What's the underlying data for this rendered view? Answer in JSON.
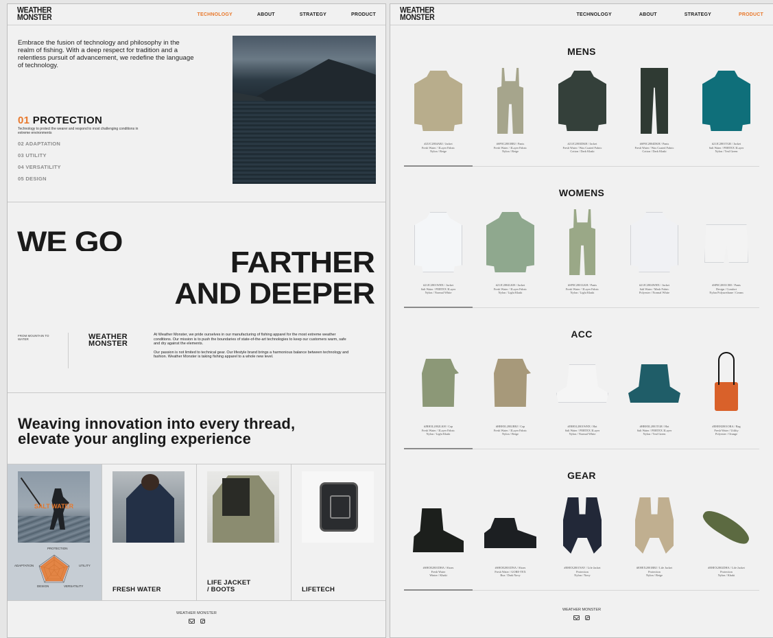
{
  "left": {
    "logo": [
      "WEATHER",
      "MONSTER"
    ],
    "nav": [
      {
        "label": "TECHNOLOGY",
        "active": true
      },
      {
        "label": "ABOUT",
        "active": false
      },
      {
        "label": "STRATEGY",
        "active": false
      },
      {
        "label": "PRODUCT",
        "active": false
      }
    ],
    "intro": "Embrace the fusion of technology and philosophy in the realm of fishing. With a deep respect for tradition and a relentless pursuit of advancement, we redefine the language of technology.",
    "tech": {
      "active_num": "01",
      "active_label": "PROTECTION",
      "active_desc": "Technology to protect the wearer and respond to most challenging conditions in extreme environments",
      "items": [
        "02 ADAPTATION",
        "03 UTILITY",
        "04 VERSATILITY",
        "05 DESIGN"
      ]
    },
    "headline1": "WE GO",
    "headline2": [
      "FARTHER",
      "AND DEEPER"
    ],
    "from_text": "FROM MOUNTAIN TO WATER",
    "brand": [
      "WEATHER",
      "MONSTER"
    ],
    "about": [
      "At Weather Monster, we pride ourselves in our manufacturing of fishing apparel for the most extreme weather conditions. Our mission is to push the boundaries of state-of-the-art technologies to keep our customers warm, safe and dry against the elements.",
      "Our passion is not limited to technical gear. Our lifestyle brand brings a harmonious balance between technology and fashion. Weather Monster is taking fishing apparel to a whole new level."
    ],
    "tagline": [
      "Weaving innovation into every thread,",
      "elevate your angling experience"
    ],
    "cards": [
      {
        "label": "SALT WATER",
        "overlay": true
      },
      {
        "label": "FRESH WATER"
      },
      {
        "label": "LIFE JACKET / BOOTS",
        "lines": [
          "LIFE JACKET",
          "/ BOOTS"
        ]
      },
      {
        "label": "LIFETECH"
      }
    ],
    "radar_labels": {
      "top": "PROTECTION",
      "left": "ADAPTATION",
      "right": "UTILITY",
      "bottom_left": "DESIGN",
      "bottom_right": "VERSATILITY"
    },
    "footer": "WEATHER MONSTER",
    "accent": "#e8782b"
  },
  "right": {
    "logo": [
      "WEATHER",
      "MONSTER"
    ],
    "nav": [
      {
        "label": "TECHNOLOGY",
        "active": false
      },
      {
        "label": "ABOUT",
        "active": false
      },
      {
        "label": "STRATEGY",
        "active": false
      },
      {
        "label": "PRODUCT",
        "active": true
      }
    ],
    "categories": [
      {
        "title": "MENS",
        "products": [
          {
            "shape": "jacket",
            "color": "#b8ad8c",
            "lines": [
              "#21JC2804ARJ / Jacket",
              "Fresh Water / 3Layer Fabric",
              "Nylon / Beige"
            ]
          },
          {
            "shape": "overall",
            "color": "#a6a58c",
            "lines": [
              "#SP0C2801BRJ / Pants",
              "Fresh Water / 3Layer Fabric",
              "Nylon / Beige"
            ]
          },
          {
            "shape": "jacket",
            "color": "#34403a",
            "lines": [
              "#21JC2803DKH / Jacket",
              "Fresh Water / Wax Coated Fabric",
              "Cotton / Dark Khaki"
            ]
          },
          {
            "shape": "pants",
            "color": "#2f3a33",
            "lines": [
              "#SP0C2804DKH / Pants",
              "Fresh Water / Wax Coated Fabric",
              "Cotton / Dark Khaki"
            ]
          },
          {
            "shape": "jacket",
            "color": "#0f6f7a",
            "lines": [
              "#21JC2801TGR / Jacket",
              "Salt Water / PERTEX 3Layer",
              "Nylon / Teal Green"
            ]
          }
        ]
      },
      {
        "title": "WOMENS",
        "products": [
          {
            "shape": "jacket",
            "color": "#f4f6f8",
            "lines": [
              "#21JC2801WHX / Jacket",
              "Salt Water / PERTEX 3Layer",
              "Nylon / Normal White"
            ]
          },
          {
            "shape": "jacket",
            "color": "#8fa88e",
            "lines": [
              "#21JC2804LKH / Jacket",
              "Fresh Water / 3Layer Fabric",
              "Nylon / Light Khaki"
            ]
          },
          {
            "shape": "overall",
            "color": "#9aa887",
            "lines": [
              "#SP0C2801LKH / Pants",
              "Fresh Water / 3Layer Fabric",
              "Nylon / Light Khaki"
            ]
          },
          {
            "shape": "jacket",
            "color": "#f0f1f4",
            "lines": [
              "#21JC2804WHX / Jacket",
              "Salt Water / Mesh Fabric",
              "Polyester / Normal White"
            ]
          },
          {
            "shape": "shorts",
            "color": "#f3f3f3",
            "lines": [
              "#SP0C2801CRE / Pants",
              "Design / Comfort",
              "Nylon Polyurethane / Cream"
            ]
          }
        ]
      },
      {
        "title": "ACC",
        "products": [
          {
            "shape": "cap1",
            "color": "#8c9877",
            "lines": [
              "#JRH3L2802LKH / Cap",
              "Fresh Water / 3Layer Fabric",
              "Nylon / Light Khaki"
            ]
          },
          {
            "shape": "cap1",
            "color": "#a7997a",
            "lines": [
              "#HRH3L2802BRJ / Cap",
              "Fresh Water / 3Layer Fabric",
              "Nylon / Beige"
            ]
          },
          {
            "shape": "hat",
            "color": "#f5f5f5",
            "lines": [
              "#JRH3L2801WHX / Hat",
              "Salt Water / PERTEX 3Layer",
              "Nylon / Normal White"
            ]
          },
          {
            "shape": "hat",
            "color": "#1f5d68",
            "lines": [
              "#HRH3L2801TGR / Hat",
              "Salt Water / PERTEX 3Layer",
              "Nylon / Teal Green"
            ]
          },
          {
            "shape": "bag",
            "color": "#d9612a",
            "lines": [
              "#EHEH2801ORA / Bag",
              "Fresh Water / Utility",
              "Polyester / Orange"
            ]
          }
        ]
      },
      {
        "title": "GEAR",
        "products": [
          {
            "shape": "boot",
            "color": "#1c1f1c",
            "lines": [
              "#SHOE2801DHA / Shoes",
              "Fresh Water",
              "Winter / Khaki"
            ]
          },
          {
            "shape": "shoe",
            "color": "#1c1f22",
            "lines": [
              "#SHOE2801DNA / Shoes",
              "Fresh Water / GORE-TEX",
              "Boa / Dark Navy"
            ]
          },
          {
            "shape": "vestj",
            "color": "#222838",
            "lines": [
              "#EHEX2801NAV / Life Jacket",
              "Protection",
              "Nylon / Navy"
            ]
          },
          {
            "shape": "vestj",
            "color": "#c0af90",
            "lines": [
              "#EHEX2801BRJ / Life Jacket",
              "Protection",
              "Nylon / Beige"
            ]
          },
          {
            "shape": "belt",
            "color": "#5c6a41",
            "lines": [
              "#EHEX2802DHA / Life Jacket",
              "Protection",
              "Nylon / Khaki"
            ]
          }
        ]
      }
    ],
    "footer": "WEATHER MONSTER"
  }
}
